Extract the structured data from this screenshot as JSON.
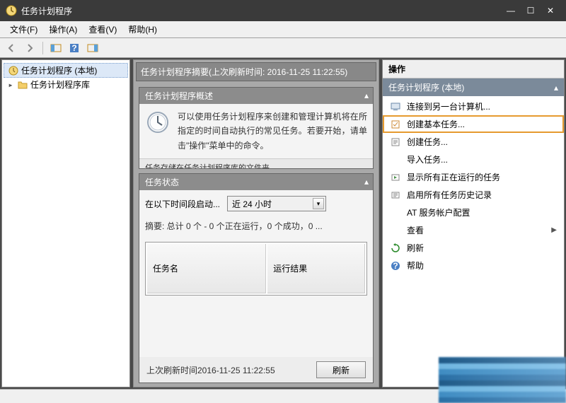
{
  "window": {
    "title": "任务计划程序"
  },
  "menu": {
    "file": "文件(F)",
    "action": "操作(A)",
    "view": "查看(V)",
    "help": "帮助(H)"
  },
  "tree": {
    "root": "任务计划程序 (本地)",
    "child": "任务计划程序库"
  },
  "summary": {
    "header": "任务计划程序摘要(上次刷新时间: 2016-11-25 11:22:55)",
    "overview_title": "任务计划程序概述",
    "overview_text": "可以使用任务计划程序来创建和管理计算机将在所指定的时间自动执行的常见任务。若要开始，请单击\"操作\"菜单中的命令。",
    "overview_trunc": "任务存储在任务计划程序库的文件夹",
    "status_title": "任务状态",
    "status_label": "在以下时间段启动...",
    "status_select": "近 24 小时",
    "status_summary": "摘要: 总计 0 个 - 0 个正在运行，0 个成功，0 ...",
    "col_name": "任务名",
    "col_result": "运行结果",
    "last_refresh": "上次刷新时间2016-11-25 11:22:55",
    "refresh_btn": "刷新"
  },
  "actions": {
    "header": "操作",
    "scope": "任务计划程序 (本地)",
    "items": {
      "connect": "连接到另一台计算机...",
      "create_basic": "创建基本任务...",
      "create_task": "创建任务...",
      "import": "导入任务...",
      "show_running": "显示所有正在运行的任务",
      "enable_history": "启用所有任务历史记录",
      "at_service": "AT 服务帐户配置",
      "view": "查看",
      "refresh": "刷新",
      "help": "帮助"
    }
  }
}
